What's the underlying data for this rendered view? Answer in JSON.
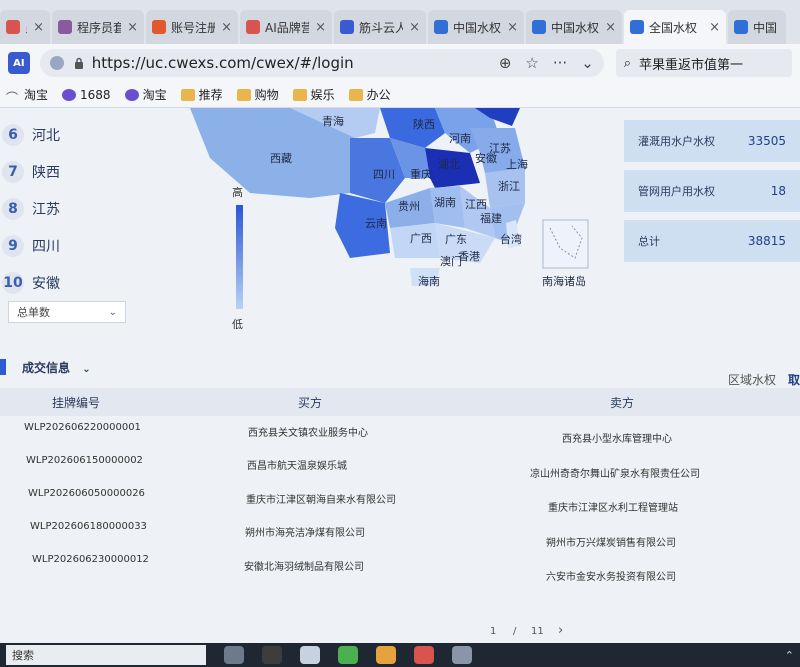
{
  "tabs": [
    {
      "label": "员套",
      "icon_color": "#d9534f",
      "active": false
    },
    {
      "label": "程序员套",
      "icon_color": "#8a5a9e",
      "active": false
    },
    {
      "label": "账号注册",
      "icon_color": "#e0582d",
      "active": false
    },
    {
      "label": "AI品牌营",
      "icon_color": "#d9534f",
      "active": false
    },
    {
      "label": "筋斗云人",
      "icon_color": "#3a5bd0",
      "active": false
    },
    {
      "label": "中国水权",
      "icon_color": "#2f6fd6",
      "active": false
    },
    {
      "label": "中国水权",
      "icon_color": "#2f6fd6",
      "active": false
    },
    {
      "label": "全国水权",
      "icon_color": "#2f6fd6",
      "active": true
    },
    {
      "label": "中国",
      "icon_color": "#2f6fd6",
      "active": false
    }
  ],
  "address": {
    "url": "https://uc.cwexs.com/cwex/#/login",
    "search_text": "苹果重返市值第一"
  },
  "bookmarks": [
    {
      "label": "淘宝",
      "type": "taobao"
    },
    {
      "label": "1688",
      "type": "ali"
    },
    {
      "label": "淘宝",
      "type": "ali"
    },
    {
      "label": "推荐",
      "type": "folder"
    },
    {
      "label": "购物",
      "type": "folder"
    },
    {
      "label": "娱乐",
      "type": "folder"
    },
    {
      "label": "办公",
      "type": "folder"
    }
  ],
  "ranking": [
    {
      "rank": "6",
      "name": "河北"
    },
    {
      "rank": "7",
      "name": "陕西"
    },
    {
      "rank": "8",
      "name": "江苏"
    },
    {
      "rank": "9",
      "name": "四川"
    },
    {
      "rank": "10",
      "name": "安徽"
    }
  ],
  "metric_select": "总单数",
  "map": {
    "legend_high": "高",
    "legend_low": "低",
    "labels": [
      "青海",
      "陕西",
      "河南",
      "西藏",
      "四川",
      "重庆",
      "湖北",
      "江苏",
      "安徽",
      "上海",
      "浙江",
      "贵州",
      "湖南",
      "江西",
      "福建",
      "云南",
      "广西",
      "广东",
      "台湾",
      "澳门",
      "香港",
      "海南",
      "南海诸岛"
    ]
  },
  "stats": [
    {
      "label": "灌溉用水户水权",
      "value": "33505"
    },
    {
      "label": "管网用户用水权",
      "value": "18"
    },
    {
      "label": "总计",
      "value": "38815"
    }
  ],
  "deals": {
    "title": "成交信息",
    "tabs": [
      "区域水权",
      "取"
    ],
    "columns": {
      "code": "挂牌编号",
      "buyer": "买方",
      "seller": "卖方"
    },
    "rows": [
      {
        "code": "WLP202606220000001",
        "buyer": "西充县关文镇农业服务中心",
        "seller": "西充县小型水库管理中心"
      },
      {
        "code": "WLP202606150000002",
        "buyer": "西昌市航天温泉娱乐城",
        "seller": "凉山州奇奇尔舞山矿泉水有限责任公司"
      },
      {
        "code": "WLP202606050000026",
        "buyer": "重庆市江津区朝海自来水有限公司",
        "seller": "重庆市江津区水利工程管理站"
      },
      {
        "code": "WLP202606180000033",
        "buyer": "朔州市海亮洁净煤有限公司",
        "seller": "朔州市万兴煤炭销售有限公司"
      },
      {
        "code": "WLP202606230000012",
        "buyer": "安徽北海羽绒制品有限公司",
        "seller": "六安市金安水务投资有限公司"
      }
    ]
  },
  "pager": {
    "current": "1",
    "sep": "/",
    "total": "11",
    "next": "›"
  },
  "taskbar": {
    "search": "搜索"
  }
}
